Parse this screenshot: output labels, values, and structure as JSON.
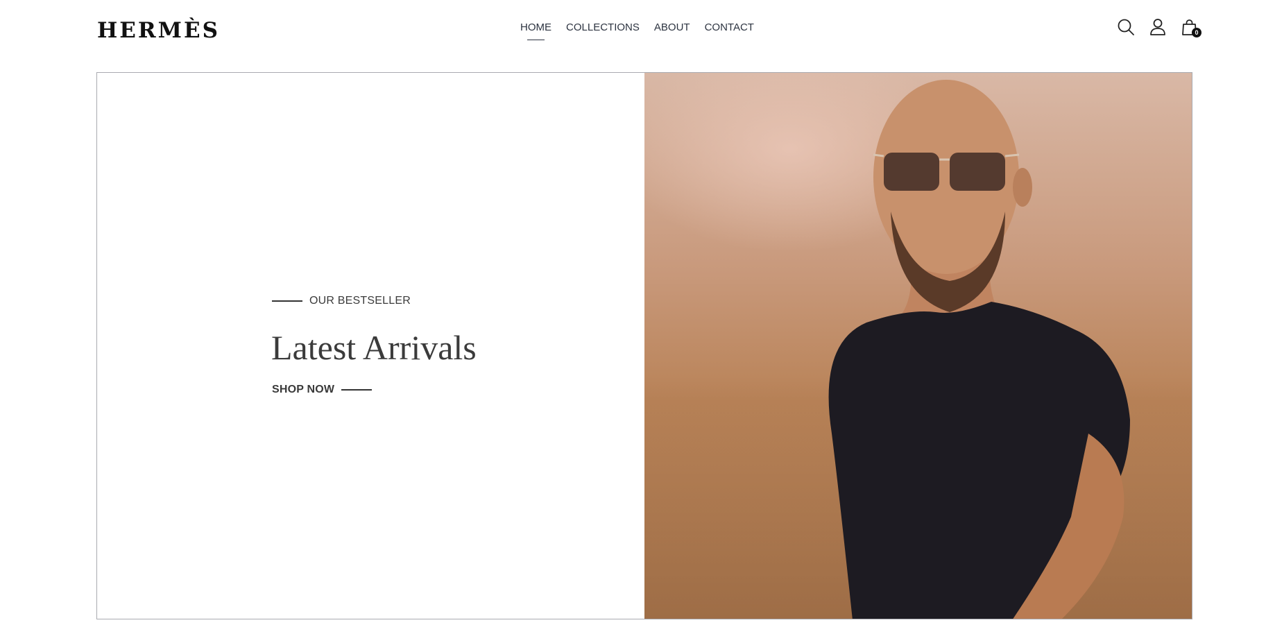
{
  "brand": {
    "logo_text": "HERMÈS"
  },
  "nav": {
    "items": [
      {
        "label": "HOME",
        "active": true
      },
      {
        "label": "COLLECTIONS",
        "active": false
      },
      {
        "label": "ABOUT",
        "active": false
      },
      {
        "label": "CONTACT",
        "active": false
      }
    ]
  },
  "header_icons": {
    "search": "search-icon",
    "account": "user-icon",
    "cart": "shopping-bag-icon",
    "cart_count": "0"
  },
  "hero": {
    "eyebrow": "OUR BESTSELLER",
    "title": "Latest Arrivals",
    "cta_label": "SHOP NOW",
    "image_alt": "man in black t-shirt and sunglasses"
  },
  "colors": {
    "text": "#3a3a3a",
    "nav_text": "#2c3340",
    "border": "#a9aab0",
    "badge": "#111111"
  }
}
